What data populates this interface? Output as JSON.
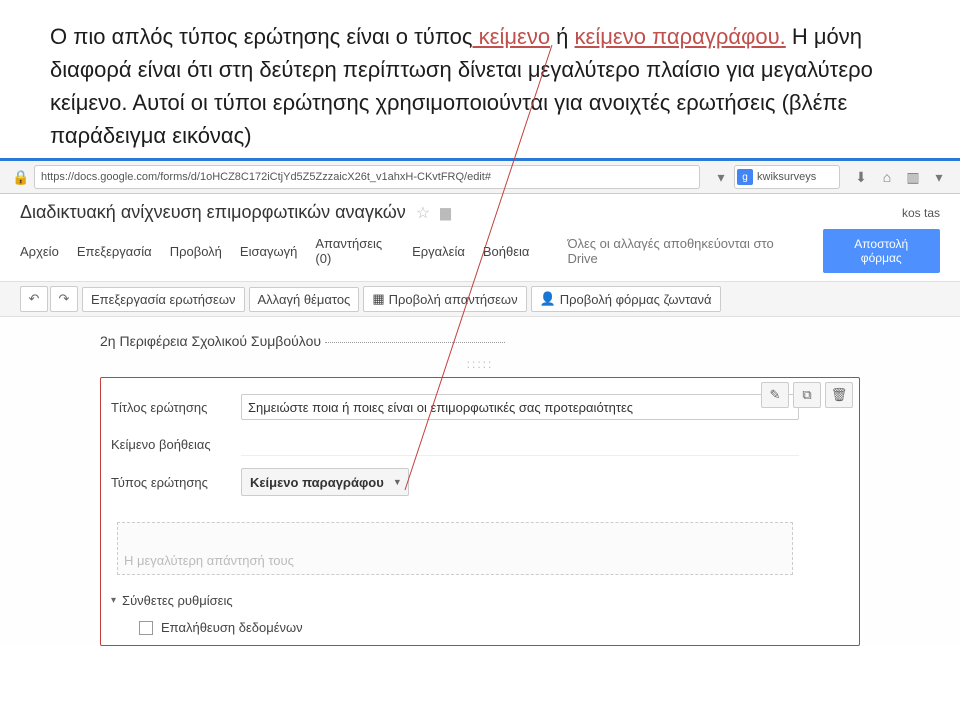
{
  "caption": {
    "t1": "Ο πιο απλός τύπος ερώτησης είναι ο τύπος",
    "link1": " κείμενο",
    "t2": " ή ",
    "link2": "κείμενο παραγράφου.",
    "t3": " Η μόνη διαφορά είναι ότι στη δεύτερη περίπτωση δίνεται μεγαλύτερο πλαίσιο για μεγαλύτερο κείμενο. Αυτοί οι τύποι ερώτησης χρησιμοποιούνται για ανοιχτές ερωτήσεις (βλέπε παράδειγμα εικόνας)"
  },
  "browser": {
    "url": "https://docs.google.com/forms/d/1oHCZ8C172iCtjYd5Z5ZzzaicX26t_v1ahxH-CKvtFRQ/edit#",
    "search_value": "kwiksurveys"
  },
  "doc": {
    "title": "Διαδικτυακή ανίχνευση επιμορφωτικών αναγκών",
    "user": "kos tas",
    "menus": {
      "m1": "Αρχείο",
      "m2": "Επεξεργασία",
      "m3": "Προβολή",
      "m4": "Εισαγωγή",
      "m5": "Απαντήσεις (0)",
      "m6": "Εργαλεία",
      "m7": "Βοήθεια"
    },
    "save_status": "Όλες οι αλλαγές αποθηκεύονται στο Drive",
    "send_btn": "Αποστολή φόρμας"
  },
  "actionbar": {
    "b1": "Επεξεργασία ερωτήσεων",
    "b2": "Αλλαγή θέματος",
    "b3": "Προβολή απαντήσεων",
    "b4": "Προβολή φόρμας ζωντανά"
  },
  "form": {
    "section_heading": "2η Περιφέρεια Σχολικού Συμβούλου",
    "handle": ":::::",
    "labels": {
      "title": "Τίτλος ερώτησης",
      "help": "Κείμενο βοήθειας",
      "type": "Τύπος ερώτησης"
    },
    "title_value": "Σημειώστε ποια ή ποιες είναι οι επιμορφωτικές σας προτεραιότητες",
    "type_value": "Κείμενο παραγράφου",
    "answer_preview": "Η μεγαλύτερη απάντησή τους",
    "advanced": "Σύνθετες ρυθμίσεις",
    "validate": "Επαλήθευση δεδομένων"
  }
}
